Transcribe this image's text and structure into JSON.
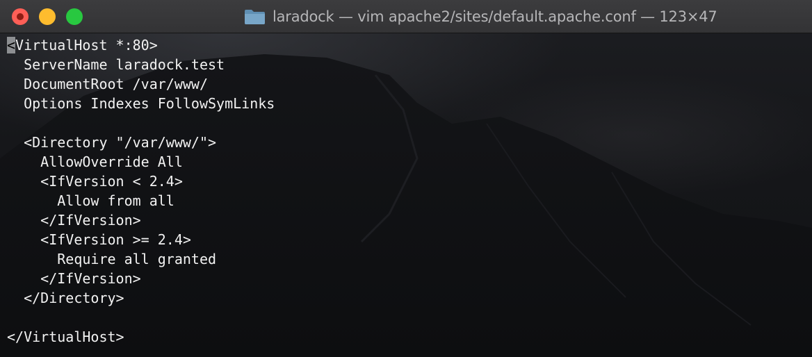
{
  "window": {
    "title": "laradock — vim apache2/sites/default.apache.conf — 123×47",
    "folder_icon": "folder-icon",
    "traffic_lights": {
      "close": "#fe5f57",
      "minimize": "#febc2e",
      "zoom": "#28c840"
    }
  },
  "editor": {
    "cursor_char": "<",
    "lines": [
      "VirtualHost *:80>",
      "  ServerName laradock.test",
      "  DocumentRoot /var/www/",
      "  Options Indexes FollowSymLinks",
      "",
      "  <Directory \"/var/www/\">",
      "    AllowOverride All",
      "    <IfVersion < 2.4>",
      "      Allow from all",
      "    </IfVersion>",
      "    <IfVersion >= 2.4>",
      "      Require all granted",
      "    </IfVersion>",
      "  </Directory>",
      "",
      "</VirtualHost>"
    ]
  }
}
